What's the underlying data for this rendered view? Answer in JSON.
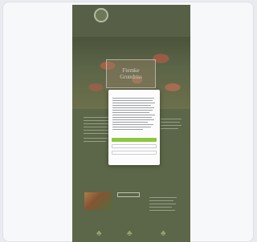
{
  "header": {
    "logo_text": "",
    "nav_row1": [
      "",
      "",
      ""
    ],
    "nav_row2": [
      "",
      "",
      "",
      ""
    ],
    "nav_row3": [
      "",
      ""
    ]
  },
  "hero": {
    "title_line1": "Fiemke",
    "title_line2": "Grundriss"
  },
  "content": {
    "intro_title": "",
    "section_title": "",
    "more_button": "",
    "side_title": ""
  },
  "consent": {
    "title": "",
    "accept_label": "",
    "button2_label": "",
    "button3_label": "",
    "link_label": ""
  },
  "colors": {
    "accent": "#8dc63f",
    "header_bg": "#4f5a3e",
    "page_bg": "#e9ebef"
  },
  "icons": [
    "logo-icon",
    "tree-icon",
    "tree-icon",
    "tree-icon"
  ]
}
